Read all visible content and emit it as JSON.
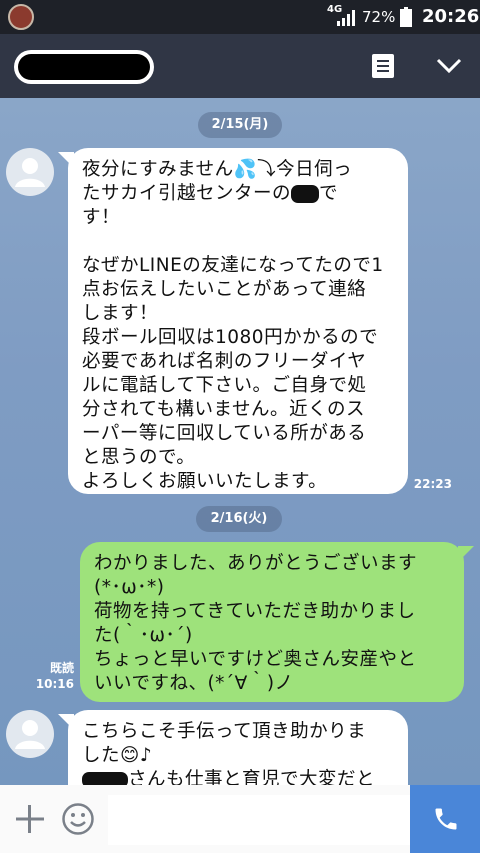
{
  "status_bar": {
    "network": "4G",
    "battery_percent": "72%",
    "time": "20:26"
  },
  "header": {
    "contact_name": "",
    "notes_icon": "notes-icon",
    "menu_icon": "chevron-down-icon"
  },
  "dates": [
    "2/15(月)",
    "2/16(火)"
  ],
  "messages": [
    {
      "side": "in",
      "lines": [
        "夜分にすみません💦⤵今日伺っ",
        "たサカイ引越センターの",
        "す！",
        "",
        "なぜかLINEの友達になってたので1",
        "点お伝えしたいことがあって連絡",
        "します！",
        "段ボール回収は1080円かかるので",
        "必要であれば名刺のフリーダイヤ",
        "ルに電話して下さい。ご自身で処",
        "分されても構いません。近くのス",
        "ーパー等に回収している所がある",
        "と思うので。",
        "よろしくお願いいたします。"
      ],
      "line2_suffix": "で",
      "time": "22:23"
    },
    {
      "side": "out",
      "lines": [
        "わかりました、ありがとうございます",
        "(*･ω･*)",
        "荷物を持ってきていただき助かりまし",
        "た(｀･ω･´)",
        "ちょっと早いですけど奥さん安産やと",
        "いいですね、(*´∀｀)ノ"
      ],
      "read_label": "既読",
      "time": "10:16"
    },
    {
      "side": "in",
      "lines": [
        "こちらこそ手伝って頂き助かりま",
        "した😊♪",
        "さんも仕事と育児で大変だと"
      ]
    }
  ],
  "footer": {
    "add_icon": "plus-icon",
    "emoji_icon": "emoji-icon",
    "input_placeholder": "",
    "call_icon": "phone-icon"
  },
  "colors": {
    "incoming_bubble": "#ffffff",
    "outgoing_bubble": "#9ee27b",
    "header": "#303645",
    "call_button": "#4a86d8"
  }
}
